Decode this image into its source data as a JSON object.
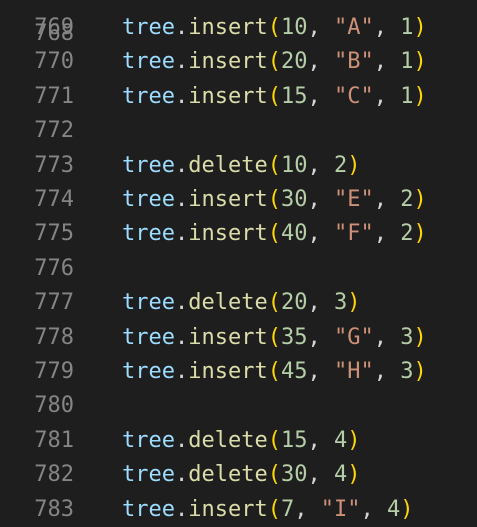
{
  "editor": {
    "top_partial_line_number": "768",
    "lines": [
      {
        "num": "769",
        "tokens": [
          "tree",
          ".",
          "insert",
          "(",
          "10",
          ", ",
          "\"A\"",
          ", ",
          "1",
          ")"
        ]
      },
      {
        "num": "770",
        "tokens": [
          "tree",
          ".",
          "insert",
          "(",
          "20",
          ", ",
          "\"B\"",
          ", ",
          "1",
          ")"
        ]
      },
      {
        "num": "771",
        "tokens": [
          "tree",
          ".",
          "insert",
          "(",
          "15",
          ", ",
          "\"C\"",
          ", ",
          "1",
          ")"
        ]
      },
      {
        "num": "772",
        "tokens": []
      },
      {
        "num": "773",
        "tokens": [
          "tree",
          ".",
          "delete",
          "(",
          "10",
          ", ",
          "2",
          ")"
        ]
      },
      {
        "num": "774",
        "tokens": [
          "tree",
          ".",
          "insert",
          "(",
          "30",
          ", ",
          "\"E\"",
          ", ",
          "2",
          ")"
        ]
      },
      {
        "num": "775",
        "tokens": [
          "tree",
          ".",
          "insert",
          "(",
          "40",
          ", ",
          "\"F\"",
          ", ",
          "2",
          ")"
        ]
      },
      {
        "num": "776",
        "tokens": []
      },
      {
        "num": "777",
        "tokens": [
          "tree",
          ".",
          "delete",
          "(",
          "20",
          ", ",
          "3",
          ")"
        ]
      },
      {
        "num": "778",
        "tokens": [
          "tree",
          ".",
          "insert",
          "(",
          "35",
          ", ",
          "\"G\"",
          ", ",
          "3",
          ")"
        ]
      },
      {
        "num": "779",
        "tokens": [
          "tree",
          ".",
          "insert",
          "(",
          "45",
          ", ",
          "\"H\"",
          ", ",
          "3",
          ")"
        ]
      },
      {
        "num": "780",
        "tokens": []
      },
      {
        "num": "781",
        "tokens": [
          "tree",
          ".",
          "delete",
          "(",
          "15",
          ", ",
          "4",
          ")"
        ]
      },
      {
        "num": "782",
        "tokens": [
          "tree",
          ".",
          "delete",
          "(",
          "30",
          ", ",
          "4",
          ")"
        ]
      },
      {
        "num": "783",
        "tokens": [
          "tree",
          ".",
          "insert",
          "(",
          "7",
          ", ",
          "\"I\"",
          ", ",
          "4",
          ")"
        ]
      }
    ]
  },
  "colors": {
    "background": "#1e1e1e",
    "line_number": "#858585",
    "variable": "#9cdcfe",
    "function": "#dcdcaa",
    "bracket": "#ffd700",
    "number": "#b5cea8",
    "string": "#ce9178",
    "punctuation": "#d4d4d4"
  }
}
